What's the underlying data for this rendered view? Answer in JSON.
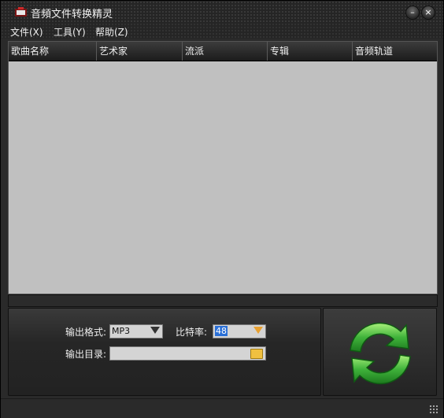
{
  "window": {
    "title": "音頻文件转换精灵"
  },
  "menu": {
    "items": [
      "文件(X)",
      "工具(Y)",
      "帮助(Z)"
    ]
  },
  "table": {
    "columns": [
      "歌曲名称",
      "艺术家",
      "流派",
      "专辑",
      "音频轨道"
    ],
    "rows": []
  },
  "settings": {
    "format_label": "输出格式:",
    "format_value": "MP3",
    "bitrate_label": "比特率:",
    "bitrate_value": "48",
    "output_dir_label": "输出目录:",
    "output_dir_value": ""
  },
  "icons": {
    "app": "app-icon",
    "minimize": "minimize-icon",
    "close": "close-icon",
    "convert": "refresh-arrows-icon",
    "folder": "folder-icon"
  },
  "colors": {
    "convert_green": "#3fb23a",
    "list_bg": "#c0c0c0"
  }
}
